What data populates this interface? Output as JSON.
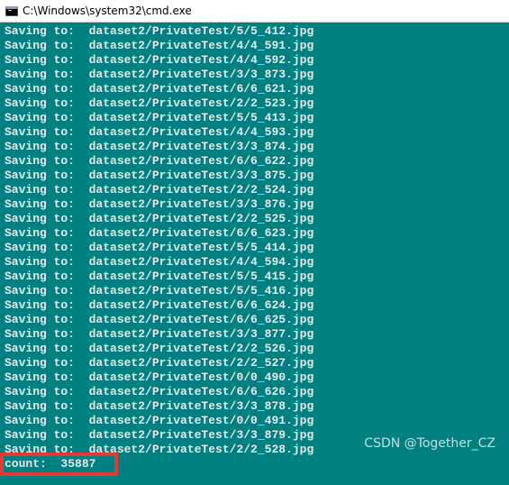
{
  "window": {
    "title": "C:\\Windows\\system32\\cmd.exe",
    "background_color": "#008080",
    "text_color": "#e8e8e8",
    "icon": "cmd-icon"
  },
  "console": {
    "lines": [
      "Saving to:  dataset2/PrivateTest/5/5_412.jpg",
      "Saving to:  dataset2/PrivateTest/4/4_591.jpg",
      "Saving to:  dataset2/PrivateTest/4/4_592.jpg",
      "Saving to:  dataset2/PrivateTest/3/3_873.jpg",
      "Saving to:  dataset2/PrivateTest/6/6_621.jpg",
      "Saving to:  dataset2/PrivateTest/2/2_523.jpg",
      "Saving to:  dataset2/PrivateTest/5/5_413.jpg",
      "Saving to:  dataset2/PrivateTest/4/4_593.jpg",
      "Saving to:  dataset2/PrivateTest/3/3_874.jpg",
      "Saving to:  dataset2/PrivateTest/6/6_622.jpg",
      "Saving to:  dataset2/PrivateTest/3/3_875.jpg",
      "Saving to:  dataset2/PrivateTest/2/2_524.jpg",
      "Saving to:  dataset2/PrivateTest/3/3_876.jpg",
      "Saving to:  dataset2/PrivateTest/2/2_525.jpg",
      "Saving to:  dataset2/PrivateTest/6/6_623.jpg",
      "Saving to:  dataset2/PrivateTest/5/5_414.jpg",
      "Saving to:  dataset2/PrivateTest/4/4_594.jpg",
      "Saving to:  dataset2/PrivateTest/5/5_415.jpg",
      "Saving to:  dataset2/PrivateTest/5/5_416.jpg",
      "Saving to:  dataset2/PrivateTest/6/6_624.jpg",
      "Saving to:  dataset2/PrivateTest/6/6_625.jpg",
      "Saving to:  dataset2/PrivateTest/3/3_877.jpg",
      "Saving to:  dataset2/PrivateTest/2/2_526.jpg",
      "Saving to:  dataset2/PrivateTest/2/2_527.jpg",
      "Saving to:  dataset2/PrivateTest/0/0_490.jpg",
      "Saving to:  dataset2/PrivateTest/6/6_626.jpg",
      "Saving to:  dataset2/PrivateTest/3/3_878.jpg",
      "Saving to:  dataset2/PrivateTest/0/0_491.jpg",
      "Saving to:  dataset2/PrivateTest/3/3_879.jpg",
      "Saving to:  dataset2/PrivateTest/2/2_528.jpg"
    ],
    "count_line": "count:  35887"
  },
  "annotation": {
    "highlight_color": "#e53935"
  },
  "watermark": {
    "text": "CSDN @Together_CZ"
  }
}
